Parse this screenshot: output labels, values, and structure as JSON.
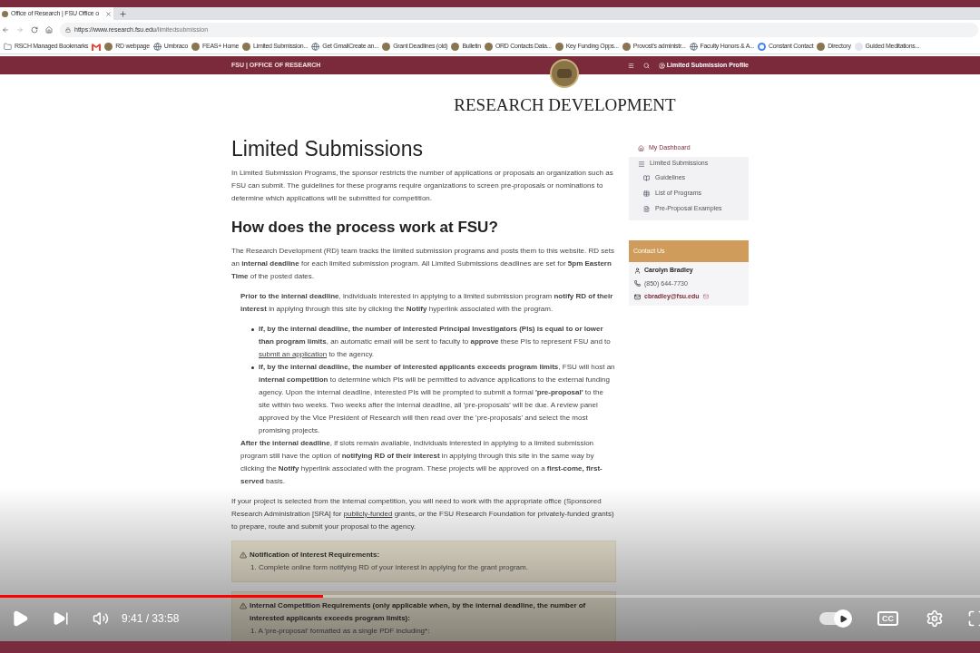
{
  "browser": {
    "tab": {
      "title": "Office of Research | FSU Office o",
      "selected": true
    },
    "url": {
      "host": "https://www.research.fsu.edu",
      "path": "/limitedsubmission"
    },
    "bookmarks": [
      {
        "kind": "folder",
        "label": "RSCH Managed Bookmarks"
      },
      {
        "kind": "gmail"
      },
      {
        "kind": "seal",
        "label": "RD webpage"
      },
      {
        "kind": "globe",
        "label": "Umbraco"
      },
      {
        "kind": "seal",
        "label": "FEAS+ Home"
      },
      {
        "kind": "seal",
        "label": "Limited Submission..."
      },
      {
        "kind": "globe",
        "label": "Get GmailCreate an..."
      },
      {
        "kind": "seal",
        "label": "Grant Deadlines (old)"
      },
      {
        "kind": "seal",
        "label": "Bulletin"
      },
      {
        "kind": "seal",
        "label": "ORD Contacts Data..."
      },
      {
        "kind": "seal",
        "label": "Key Funding Opps..."
      },
      {
        "kind": "seal",
        "label": "Provost's administr..."
      },
      {
        "kind": "globe",
        "label": "Faculty Honors & A..."
      },
      {
        "kind": "google",
        "label": "Constant Contact"
      },
      {
        "kind": "seal",
        "label": "Directory"
      },
      {
        "kind": "faint",
        "label": "Guided Meditations..."
      }
    ]
  },
  "site_header": {
    "title": "FSU | OFFICE OF RESEARCH",
    "profile": "Limited Submission Profile",
    "banner": "RESEARCH DEVELOPMENT"
  },
  "main": {
    "title": "Limited Submissions",
    "blocks": [
      {
        "kind": "p",
        "parts": [
          {
            "kind": "text",
            "text": "In Limited Submission Programs, the sponsor restricts the number of applications or proposals an organization such as FSU can submit. The guidelines for these programs require organizations to screen pre-proposals or nominations to determine which applications will be submitted for competition."
          }
        ]
      },
      {
        "kind": "heading",
        "text": "How does the process work at FSU?"
      },
      {
        "kind": "p",
        "parts": [
          {
            "kind": "text",
            "text": "The Research Development (RD) team tracks the limited submission programs and posts them to this website. RD sets an **internal deadline** for each limited submission program. All Limited Submissions deadlines are set for **5pm Eastern Time** of the posted dates."
          }
        ]
      },
      {
        "kind": "indent",
        "parts": [
          {
            "kind": "text",
            "text": "**Prior to the internal deadline**, individuals interested in applying to a limited submission program **notify RD of their interest** in applying through this site by clicking the **Notify** hyperlink associated with the program."
          }
        ]
      },
      {
        "kind": "bullet",
        "parts": [
          {
            "kind": "text",
            "text": "**If, by the internal deadline, the number of interested Principal Investigators (PIs) is equal to or lower than program limits**, an automatic email will be sent to faculty to **approve** these PIs to represent FSU and to "
          },
          {
            "kind": "link",
            "text": "submit an application"
          },
          {
            "kind": "text",
            "text": " to the agency."
          }
        ]
      },
      {
        "kind": "bullet",
        "parts": [
          {
            "kind": "text",
            "text": "**If, by the internal deadline, the number of interested applicants exceeds program limits**, FSU will host an **internal competition** to determine which PIs will be permitted to advance applications to the external funding agency. Upon the internal deadline, interested PIs will be prompted to submit a formal **'pre-proposal'** to the site within two weeks. Two weeks after the internal deadline, all 'pre-proposals' will be due. A review panel approved by the Vice President of Research will then read over the 'pre-proposals' and select the most promising projects."
          }
        ]
      },
      {
        "kind": "indent",
        "parts": [
          {
            "kind": "text",
            "text": "**After the internal deadline**, if slots remain available, individuals interested in applying to a limited submission program still have the option of **notifying RD of their interest** in applying through this site in the same way by clicking the **Notify** hyperlink associated with the program. These projects will be approved on a **first-come, first-served** basis."
          }
        ]
      },
      {
        "kind": "p",
        "parts": [
          {
            "kind": "text",
            "text": "If your project is selected from the internal competition, you will need to work with the appropriate office (Sponsored Research Administration [SRA] for "
          },
          {
            "kind": "link",
            "text": "publicly-funded"
          },
          {
            "kind": "text",
            "text": " grants, or the FSU Research Foundation for privately-funded grants) to prepare, route and submit your proposal to the agency."
          }
        ]
      },
      {
        "kind": "notice",
        "title": "Notification of Interest Requirements:",
        "items": [
          "1. Complete online form notifying RD of your interest in applying for the grant program."
        ]
      },
      {
        "kind": "notice",
        "title": "Internal Competition Requirements (only applicable when, by the internal deadline, the number of interested applicants exceeds program limits):",
        "items": [
          "1. A 'pre-proposal' formatted as a single PDF including*:"
        ]
      }
    ]
  },
  "sidebar": {
    "nav": [
      {
        "kind": "home",
        "label": "My Dashboard"
      },
      {
        "kind": "menu",
        "label": "Limited Submissions",
        "children": [
          {
            "kind": "book",
            "label": "Guidelines"
          },
          {
            "kind": "table",
            "label": "List of Programs"
          },
          {
            "kind": "file",
            "label": "Pre-Proposal Examples"
          }
        ]
      }
    ],
    "contact": {
      "title": "Contact Us",
      "name": "Carolyn Bradley",
      "phone": "(850) 644-7730",
      "email": "cbradley@fsu.edu"
    }
  },
  "player": {
    "progress": {
      "level": 0.33
    },
    "time": "9:41 / 33:58",
    "autoplay": {
      "on": true
    },
    "cc_label": "CC"
  }
}
